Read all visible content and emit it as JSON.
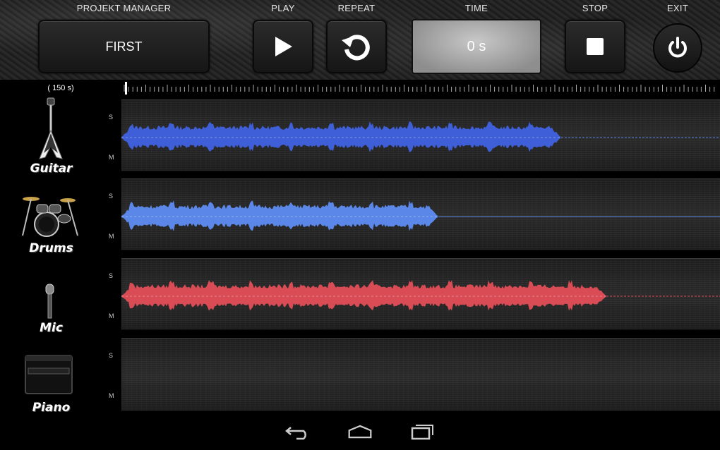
{
  "controls": {
    "project_label": "PROJEKT MANAGER",
    "project_value": "FIRST",
    "play_label": "PLAY",
    "repeat_label": "REPEAT",
    "time_label": "TIME",
    "time_value": "0 s",
    "stop_label": "STOP",
    "exit_label": "EXIT"
  },
  "timeline": {
    "length_label": "( 150 s)"
  },
  "tracks": [
    {
      "name": "Guitar",
      "s_label": "S",
      "m_label": "M",
      "color": "#3f5fd9",
      "line_color": "#5b7ee8",
      "progress": 0.735
    },
    {
      "name": "Drums",
      "s_label": "S",
      "m_label": "M",
      "color": "#5b88e8",
      "line_color": "#5b88e8",
      "progress": 0.53
    },
    {
      "name": "Mic",
      "s_label": "S",
      "m_label": "M",
      "color": "#d94c55",
      "line_color": "#d94c55",
      "progress": 0.81
    },
    {
      "name": "Piano",
      "s_label": "S",
      "m_label": "M",
      "color": "#888888",
      "line_color": "#888888",
      "progress": 0.0
    }
  ],
  "icons": {
    "play": "play-icon",
    "repeat": "repeat-icon",
    "stop": "stop-icon",
    "exit": "power-icon",
    "nav_back": "back-icon",
    "nav_home": "home-icon",
    "nav_recents": "recents-icon"
  }
}
